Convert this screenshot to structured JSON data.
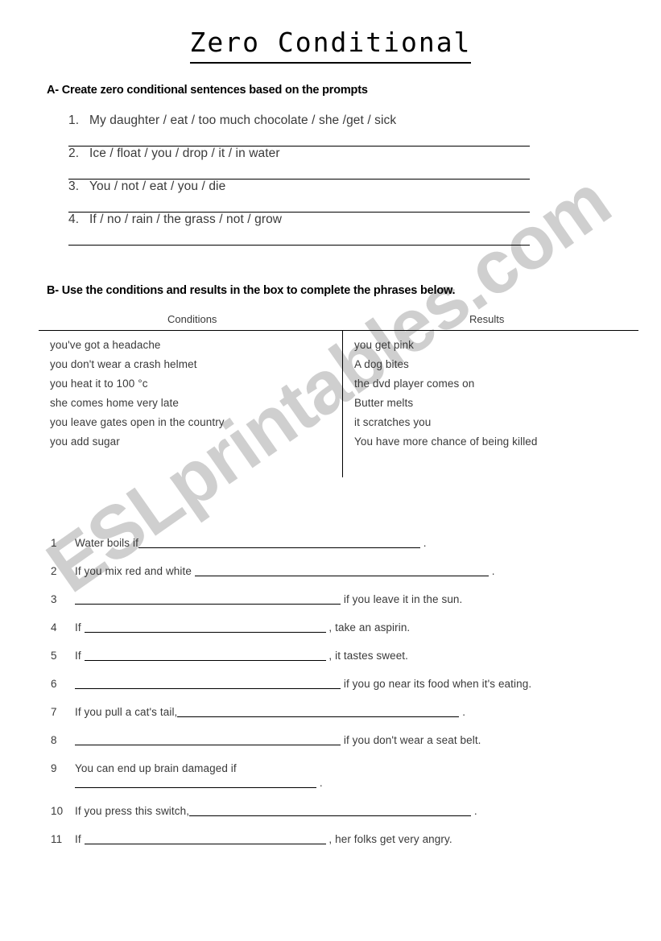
{
  "document": {
    "title": "Zero Conditional",
    "watermark": "ESLprintables.com",
    "watermark_color": "#cfcfcf",
    "text_color": "#3a3a3a"
  },
  "section_a": {
    "heading": "A- Create zero conditional sentences based on the prompts",
    "items": [
      {
        "number": "1.",
        "text": "My daughter / eat / too much chocolate / she /get / sick"
      },
      {
        "number": "2.",
        "text": "Ice / float / you / drop / it / in water"
      },
      {
        "number": "3.",
        "text": "You / not / eat / you / die"
      },
      {
        "number": "4.",
        "text": "If / no / rain / the grass / not / grow"
      }
    ]
  },
  "section_b": {
    "heading": "B- Use the conditions and results in the box to complete the phrases below.",
    "box": {
      "conditions_label": "Conditions",
      "results_label": "Results",
      "conditions": [
        "you've got a headache",
        "you don't wear a crash helmet",
        "you heat it to 100 °c",
        "she comes home very late",
        "you leave gates open in the country",
        "you add sugar"
      ],
      "results": [
        "you get pink",
        "A dog bites",
        "the dvd player comes on",
        "Butter melts",
        "it scratches you",
        "You have more chance of being killed"
      ]
    },
    "blanks": [
      {
        "number": "1",
        "before": "Water boils if",
        "after": "."
      },
      {
        "number": "2",
        "before": "If you mix red and white",
        "after": "."
      },
      {
        "number": "3",
        "before": "",
        "after": "if you leave it in the sun."
      },
      {
        "number": "4",
        "before": "If",
        "after": ", take an aspirin."
      },
      {
        "number": "5",
        "before": "If",
        "after": ", it tastes sweet."
      },
      {
        "number": "6",
        "before": "",
        "after": "if you go near its food when it's eating."
      },
      {
        "number": "7",
        "before": "If you pull a cat's tail,",
        "after": "."
      },
      {
        "number": "8",
        "before": "",
        "after": "if you don't wear a seat belt."
      },
      {
        "number": "9",
        "before": "You can end up brain damaged if",
        "after": "."
      },
      {
        "number": "10",
        "before": "If you press this switch,",
        "after": "."
      },
      {
        "number": "11",
        "before": "If",
        "after": ", her folks get very angry."
      }
    ]
  }
}
